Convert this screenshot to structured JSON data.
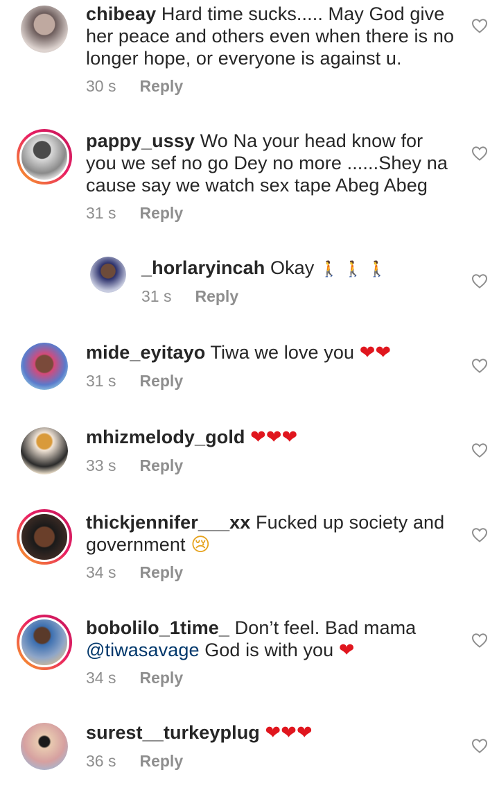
{
  "comments": [
    {
      "username": "chibeay",
      "text": "Hard time sucks..... May God give",
      "text2": "her peace and others even when there is no",
      "text3": "longer hope, or everyone is against u.",
      "time": "30 s",
      "reply": "Reply"
    },
    {
      "username": "pappy_ussy",
      "text": "Wo Na your head know for",
      "text2": "you we sef no go Dey no more ......Shey na",
      "text3": "cause say we watch sex tape Abeg Abeg",
      "time": "31 s",
      "reply": "Reply"
    },
    {
      "username": "_horlaryincah",
      "text": "Okay",
      "emoji": "🚶 🚶 🚶",
      "time": "31 s",
      "reply": "Reply"
    },
    {
      "username": "mide_eyitayo",
      "text": "Tiwa we love you",
      "emoji": "❤❤",
      "time": "31 s",
      "reply": "Reply"
    },
    {
      "username": "mhizmelody_gold",
      "emoji": "❤❤❤",
      "time": "33 s",
      "reply": "Reply"
    },
    {
      "username": "thickjennifer___xx",
      "text": "Fucked up society and",
      "text2": "government",
      "emoji": "😢",
      "time": "34 s",
      "reply": "Reply"
    },
    {
      "username": "bobolilo_1time_",
      "text": "Don’t feel. Bad mama",
      "mention": "@tiwasavage",
      "text2": "God is with you",
      "emoji": "❤",
      "time": "34 s",
      "reply": "Reply"
    },
    {
      "username": "surest__turkeyplug",
      "emoji": "❤❤❤",
      "time": "36 s",
      "reply": "Reply"
    }
  ],
  "colors": {
    "username": "#262626",
    "meta": "#8e8e8e",
    "mention": "#00376b",
    "heart_emoji": "#e0161e",
    "story_ring_start": "#f9a825",
    "story_ring_end": "#c2185b"
  },
  "icons": {
    "like": "heart-outline-icon"
  }
}
